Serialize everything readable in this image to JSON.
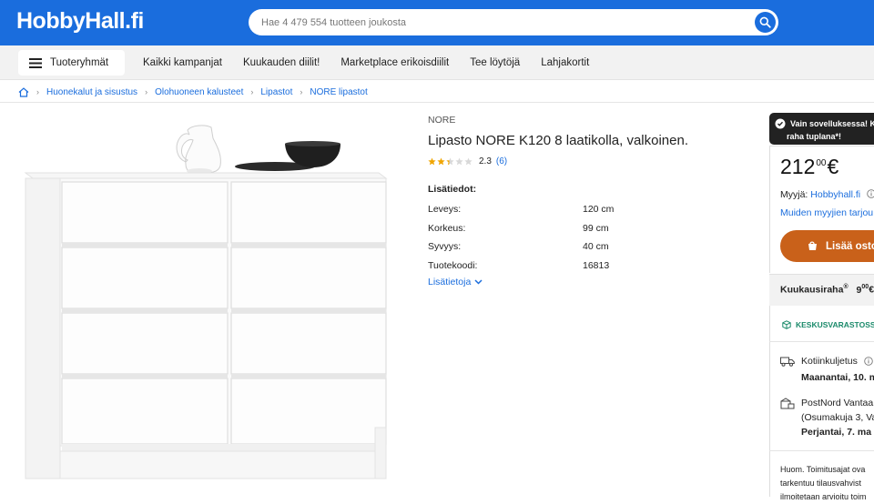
{
  "header": {
    "logo": "HobbyHall.fi",
    "search_placeholder": "Hae 4 479 554 tuotteen joukosta"
  },
  "nav": {
    "menu_label": "Tuoteryhmät",
    "links": [
      "Kaikki kampanjat",
      "Kuukauden diilit!",
      "Marketplace erikoisdiilit",
      "Tee löytöjä",
      "Lahjakortit"
    ]
  },
  "breadcrumbs": [
    "Huonekalut ja sisustus",
    "Olohuoneen kalusteet",
    "Lipastot",
    "NORE lipastot"
  ],
  "product": {
    "brand": "NORE",
    "title": "Lipasto NORE K120 8 laatikolla, valkoinen.",
    "rating_value": "2.3",
    "rating_stars": 2.3,
    "rating_count": "(6)",
    "details_heading": "Lisätiedot:",
    "specs": [
      {
        "key": "Leveys:",
        "value": "120 cm"
      },
      {
        "key": "Korkeus:",
        "value": "99 cm"
      },
      {
        "key": "Syvyys:",
        "value": "40 cm"
      },
      {
        "key": "Tuotekoodi:",
        "value": "16813"
      }
    ],
    "more_info": "Lisätietoja"
  },
  "purchase": {
    "promo_line1": "Vain sovelluksessa! K",
    "promo_line2": "raha tuplana*!",
    "price_main": "212",
    "price_cents": "00",
    "currency": "€",
    "seller_label": "Myyjä:",
    "seller_name": "Hobbyhall.fi",
    "other_sellers": "Muiden myyjien tarjou",
    "add_button": "Lisää osto",
    "monthly_label": "Kuukausiraha",
    "monthly_reg": "®",
    "monthly_amount": "9",
    "monthly_cents": "00",
    "monthly_currency": "€"
  },
  "delivery": {
    "stock": "KESKUSVARASTOSSA",
    "home_label": "Kotiinkuljetus",
    "home_date": "Maanantai, 10. m",
    "pickup_line1": "PostNord Vantaa",
    "pickup_line2": "(Osumakuja 3, Va",
    "pickup_date": "Perjantai, 7. ma",
    "note_line1": "Huom. Toimitusajat ova",
    "note_line2": "tarkentuu tilausvahvist",
    "note_line3": "ilmoitetaan arvioitu toim"
  },
  "colors": {
    "brand_blue": "#1a6ddd",
    "cta_orange": "#c9611a",
    "stock_green": "#1a8a6a",
    "star_gold": "#f0a500"
  }
}
